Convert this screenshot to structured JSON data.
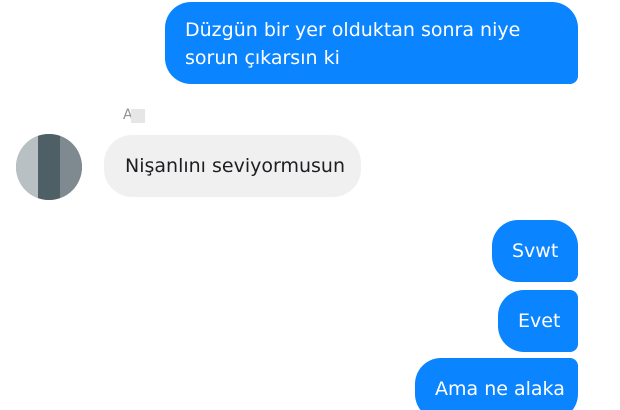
{
  "conversation": {
    "messages": [
      {
        "direction": "outgoing",
        "text": "Düzgün bir yer olduktan sonra niye sorun çıkarsın ki"
      },
      {
        "direction": "incoming",
        "text": "Nişanlını seviyormusun"
      },
      {
        "direction": "outgoing",
        "text": "Svwt"
      },
      {
        "direction": "outgoing",
        "text": "Evet"
      },
      {
        "direction": "outgoing",
        "text": "Ama ne alaka"
      }
    ],
    "sender_name": "A"
  },
  "colors": {
    "outgoing_bubble": "#0a84ff",
    "incoming_bubble": "#f1f0f0",
    "background": "#ffffff"
  },
  "icons": {
    "avatar": "blurred-profile-avatar"
  }
}
